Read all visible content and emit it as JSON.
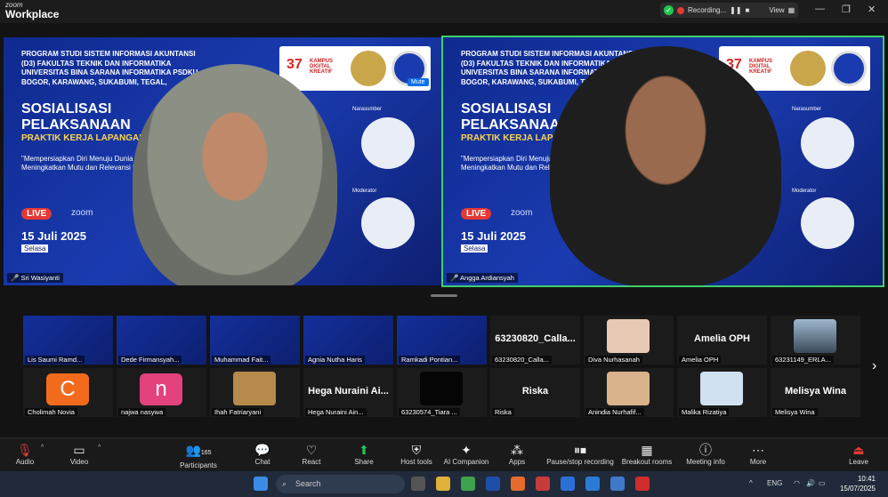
{
  "app": {
    "logo_top": "zoom",
    "logo_bottom": "Workplace"
  },
  "recording": {
    "label": "Recording...",
    "view": "View"
  },
  "slide": {
    "header": "PROGRAM STUDI SISTEM INFORMASI AKUNTANSI (D3) FAKULTAS TEKNIK DAN INFORMATIKA UNIVERSITAS BINA SARANA INFORMATIKA PSDKU BOGOR, KARAWANG, SUKABUMI, TEGAL,",
    "title1": "SOSIALISASI",
    "title2": "PELAKSANAAN",
    "title3": "PRAKTIK KERJA LAPANGAN",
    "quote": "\"Mempersiapkan Diri Menuju Dunia Kerja: Strategi Meningkatkan Mutu dan Relevansi Luaran PKL\"",
    "live": "LIVE",
    "zoom": "zoom",
    "date": "15 Juli 2025",
    "day": "Selasa",
    "logo_number": "37",
    "logo_text": "KAMPUS DIGITAL KREATIF",
    "narasumber": "Narasumber",
    "moderator": "Moderator"
  },
  "main_tiles": [
    {
      "name": "Sri Wasiyanti",
      "muted": "Mute"
    },
    {
      "name": "Angga Ardiansyah"
    }
  ],
  "thumbs_row1": [
    {
      "name": "Lis Saumi Ramd..."
    },
    {
      "name": "Dede Firmansyah..."
    },
    {
      "name": "Muhammad Fait..."
    },
    {
      "name": "Agnia Nutha Haris"
    },
    {
      "name": "Ramkadi Pontian..."
    },
    {
      "name": "63230820_Calla...",
      "big": "63230820_Calla..."
    },
    {
      "name": "Diva Nurhasanah"
    },
    {
      "name": "Amelia OPH",
      "big": "Amelia OPH"
    },
    {
      "name": "63231149_ERLA..."
    }
  ],
  "thumbs_row2": [
    {
      "name": "Cholimah Novia",
      "initial": "C"
    },
    {
      "name": "najwa nasywa",
      "initial": "n"
    },
    {
      "name": "Ihah Fatriaryani"
    },
    {
      "name": "Hega Nuraini Ain...",
      "big": "Hega Nuraini Ai..."
    },
    {
      "name": "63230574_Tiara ..."
    },
    {
      "name": "Riska",
      "big": "Riska"
    },
    {
      "name": "Anindia Nurhafif..."
    },
    {
      "name": "Malika Rizatiya"
    },
    {
      "name": "Melisya Wina",
      "big": "Melisya Wina"
    }
  ],
  "toolbar": {
    "audio": "Audio",
    "video": "Video",
    "participants": "Participants",
    "participants_count": "165",
    "chat": "Chat",
    "react": "React",
    "share": "Share",
    "host_tools": "Host tools",
    "ai": "AI Companion",
    "apps": "Apps",
    "pause": "Pause/stop recording",
    "breakout": "Breakout rooms",
    "meeting_info": "Meeting info",
    "more": "More",
    "leave": "Leave"
  },
  "taskbar": {
    "search": "Search",
    "lang": "ENG",
    "time": "10:41",
    "date": "15/07/2025"
  },
  "colors": {
    "accent_green": "#3fcf6a",
    "zoom_blue": "#0e71eb",
    "record_red": "#e53935"
  }
}
